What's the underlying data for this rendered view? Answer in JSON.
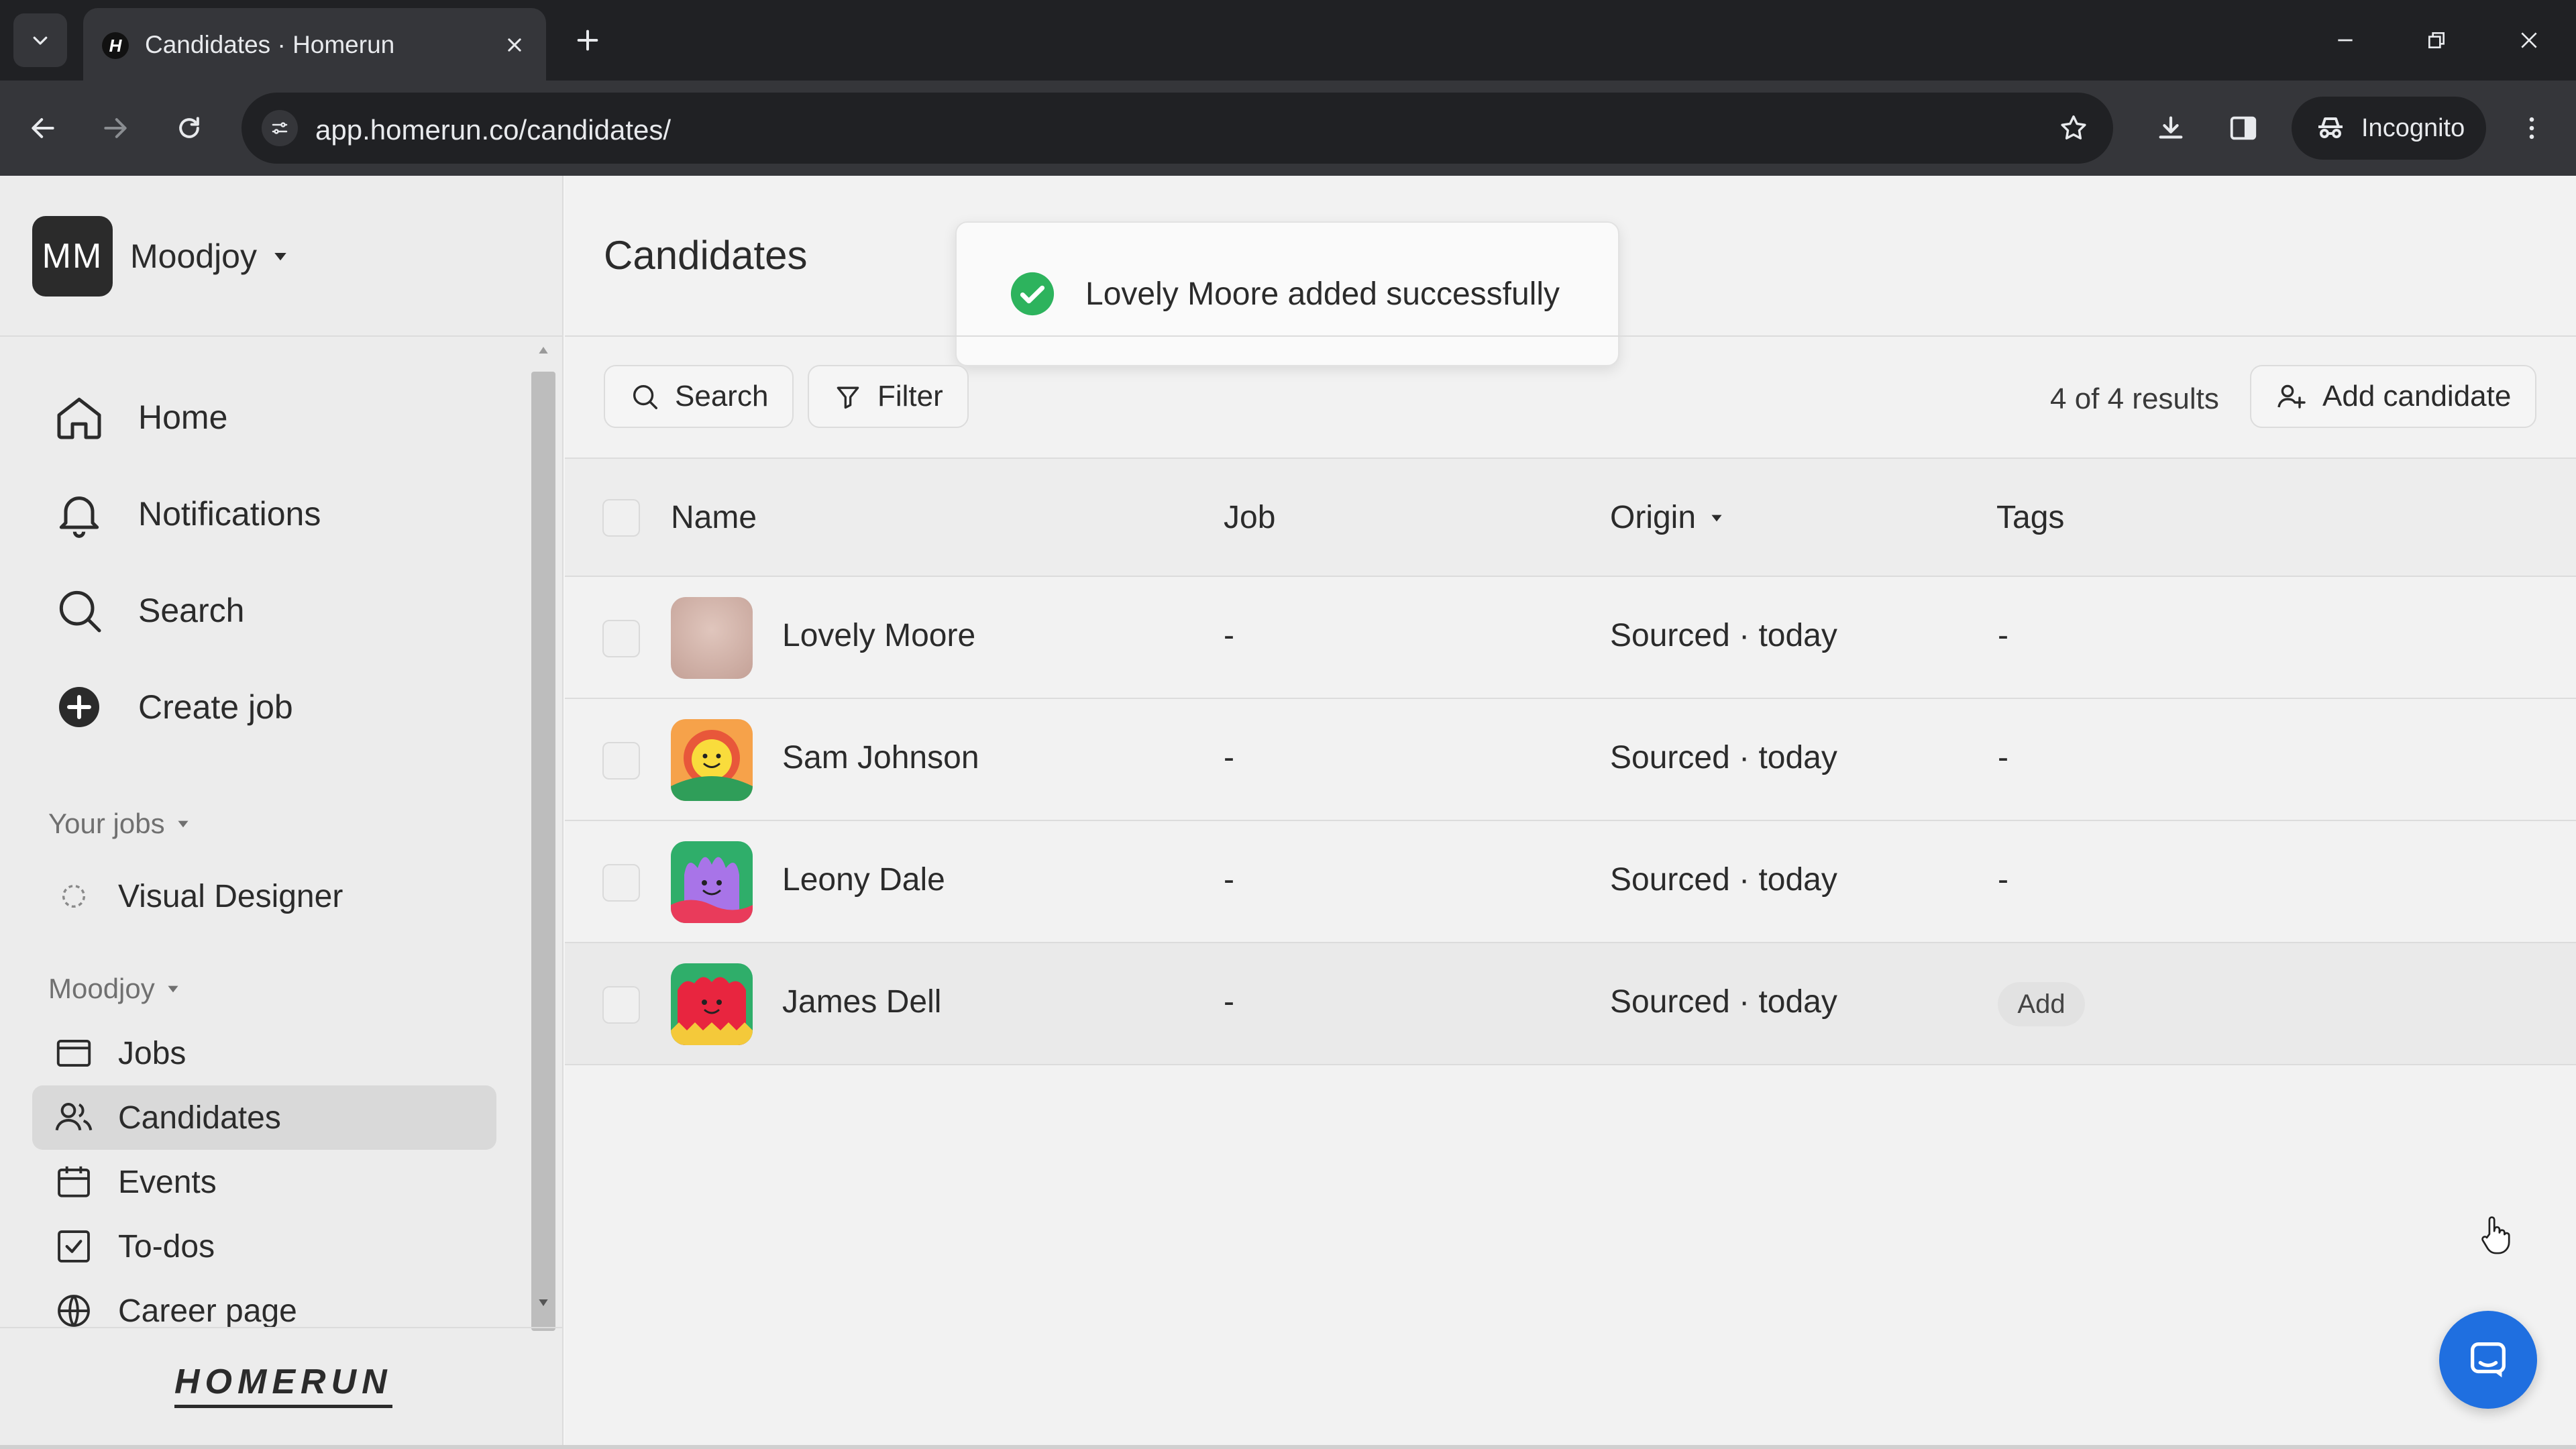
{
  "browser": {
    "tab_title": "Candidates · Homerun",
    "favicon_letter": "H",
    "url": "app.homerun.co/candidates/",
    "incognito_label": "Incognito"
  },
  "sidebar": {
    "org_initials": "MM",
    "org_name": "Moodjoy",
    "main_nav": [
      {
        "label": "Home",
        "icon": "home-icon"
      },
      {
        "label": "Notifications",
        "icon": "bell-icon"
      },
      {
        "label": "Search",
        "icon": "search-icon"
      },
      {
        "label": "Create job",
        "icon": "plus-circle-icon"
      }
    ],
    "your_jobs_heading": "Your jobs",
    "jobs": [
      {
        "label": "Visual Designer",
        "icon": "dashed-circle-icon"
      }
    ],
    "workspace_heading": "Moodjoy",
    "workspace_nav": [
      {
        "label": "Jobs",
        "icon": "browser-window-icon"
      },
      {
        "label": "Candidates",
        "icon": "users-icon",
        "active": true
      },
      {
        "label": "Events",
        "icon": "calendar-icon"
      },
      {
        "label": "To-dos",
        "icon": "checkbox-icon"
      },
      {
        "label": "Career page",
        "icon": "globe-icon"
      }
    ],
    "logo_text": "HOMERUN"
  },
  "main": {
    "title": "Candidates",
    "toast": "Lovely Moore added successfully",
    "search_label": "Search",
    "filter_label": "Filter",
    "results_text": "4 of 4 results",
    "add_candidate_label": "Add candidate",
    "columns": {
      "name": "Name",
      "job": "Job",
      "origin": "Origin",
      "tags": "Tags"
    },
    "rows": [
      {
        "name": "Lovely Moore",
        "job": "-",
        "origin": "Sourced · today",
        "tags": "-",
        "avatar": "blurred-photo"
      },
      {
        "name": "Sam Johnson",
        "job": "-",
        "origin": "Sourced · today",
        "tags": "-",
        "avatar": "orange-smiley"
      },
      {
        "name": "Leony Dale",
        "job": "-",
        "origin": "Sourced · today",
        "tags": "-",
        "avatar": "purple-monster"
      },
      {
        "name": "James Dell",
        "job": "-",
        "origin": "Sourced · today",
        "tags": "Add",
        "avatar": "red-tomato"
      }
    ]
  },
  "colors": {
    "accent_green": "#2db35d",
    "chat_blue": "#1f6fe0",
    "active_nav_bg": "#d9d9d9"
  }
}
